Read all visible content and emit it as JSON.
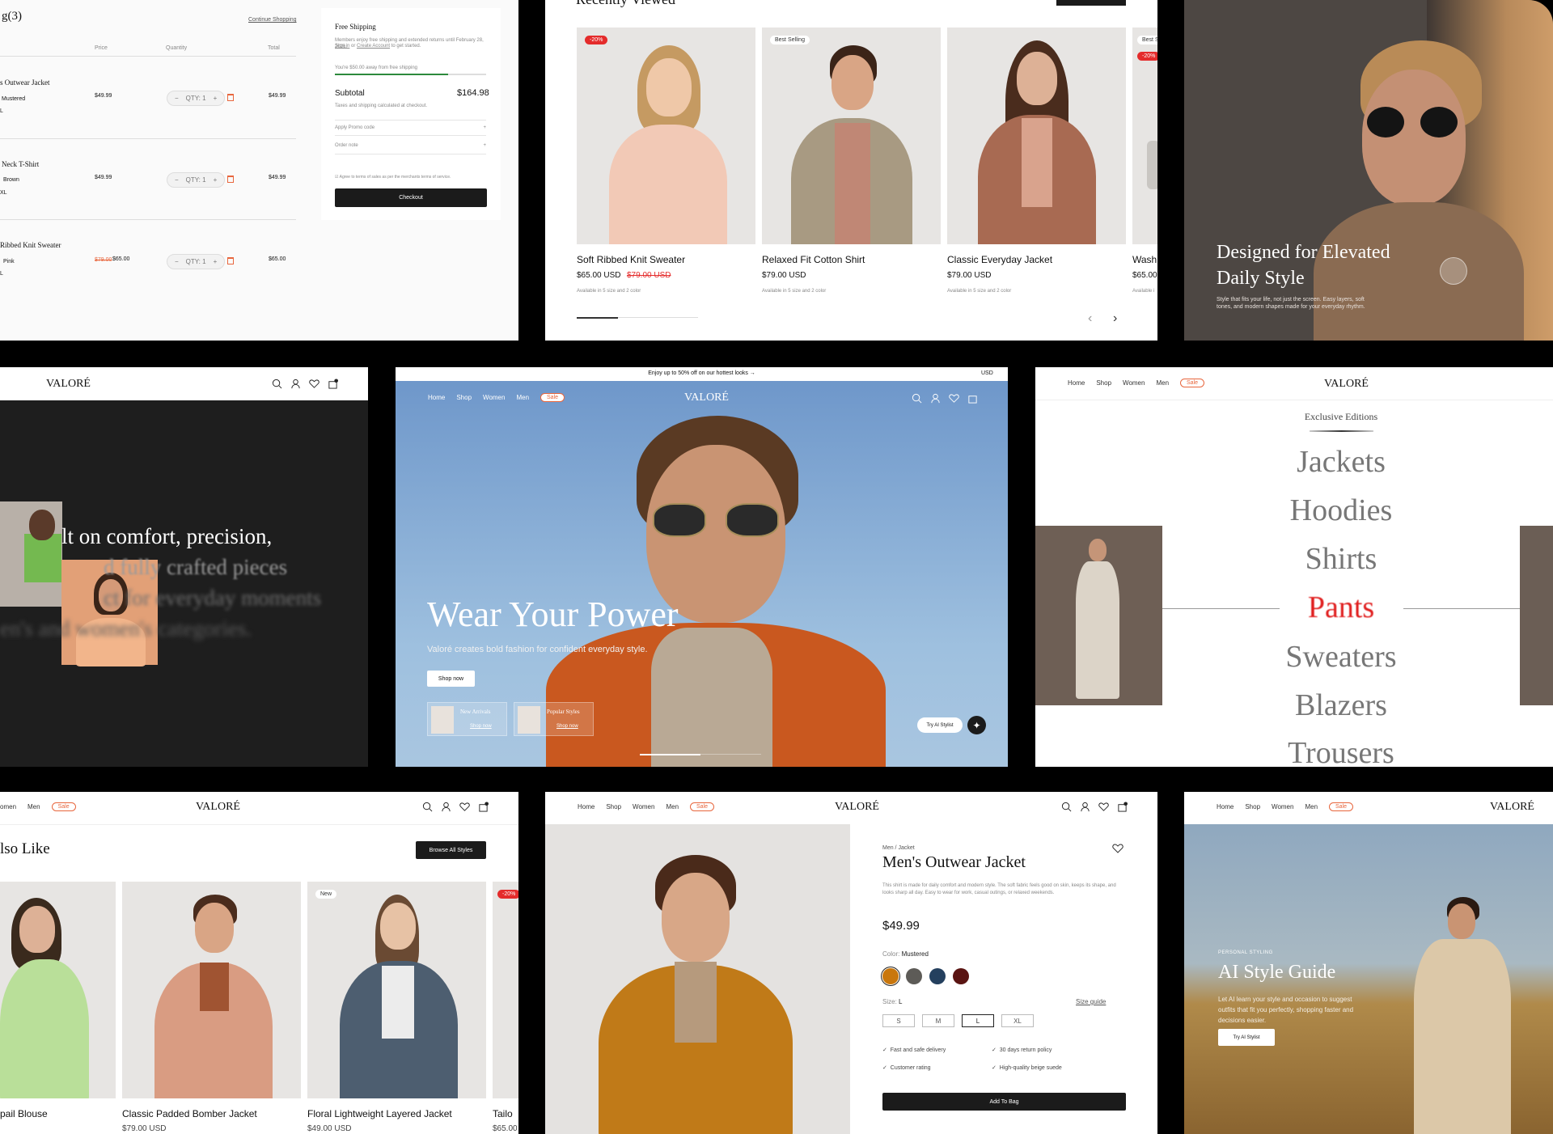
{
  "brand": "VALORÉ",
  "nav": {
    "home": "Home",
    "shop": "Shop",
    "women": "Women",
    "men": "Men",
    "sale": "Sale",
    "women_partial": "omen"
  },
  "cart": {
    "title_partial": "g(3)",
    "continue": "Continue Shopping",
    "headers": [
      "Price",
      "Quantity",
      "Total"
    ],
    "items": [
      {
        "name": "s Outwear Jacket",
        "variant": "Mustered",
        "size": "L",
        "price": "$49.99",
        "qty": "QTY: 1",
        "total": "$49.99"
      },
      {
        "name": "Neck T-Shirt",
        "variant": "Brown",
        "size": "XL",
        "price": "$49.99",
        "qty": "QTY: 1",
        "total": "$49.99"
      },
      {
        "name": "Ribbed Knit Sweater",
        "variant": "Pink",
        "size": "L",
        "old_price": "$79.00",
        "price": "$65.00",
        "qty": "QTY: 1",
        "total": "$65.00"
      }
    ],
    "summary": {
      "shipping_title": "Free Shipping",
      "shipping_text": "Members enjoy free shipping and extended returns until February 28, 2026.",
      "sign_in": "Sign in",
      "or": "or",
      "create": "Create Account",
      "to_start": "to get started.",
      "progress_text": "You're $50.00 away from free shipping",
      "progress": 0.75,
      "subtotal_label": "Subtotal",
      "subtotal": "$164.98",
      "taxes": "Taxes and shipping calculated at checkout.",
      "promo": "Apply Promo code",
      "note": "Order note",
      "terms": "Agree to terms of sales as per the merchants terms of service.",
      "checkout": "Checkout"
    }
  },
  "recent": {
    "title_partial": "Recently Viewed",
    "items": [
      {
        "badge": "-20%",
        "name": "Soft Ribbed Knit Sweater",
        "price": "$65.00 USD",
        "old": "$79.00 USD",
        "avail": "Available in 5 size and 2 color"
      },
      {
        "badge": "Best Selling",
        "name": "Relaxed Fit Cotton Shirt",
        "price": "$79.00 USD",
        "avail": "Available in 5 size and 2 color"
      },
      {
        "name": "Classic Everyday Jacket",
        "price": "$79.00 USD",
        "avail": "Available in 5 size and 2 color"
      },
      {
        "badge": "Best S",
        "badge2": "-20%",
        "name": "Wash",
        "price": "$65.00",
        "avail": "Available i"
      }
    ]
  },
  "elevated": {
    "title": "Designed for Elevated Daily Style",
    "text": "Style that fits your life, not just the screen. Easy layers, soft tones, and modern shapes made for your everyday rhythm."
  },
  "about": {
    "line1": "lt on comfort, precision,",
    "line2": "d fully crafted pieces",
    "line3": "ct for everyday moments",
    "line4": "en's and women's categories."
  },
  "hero": {
    "promo": "Enjoy up to 50% off on our hottest looks →",
    "currency": "USD",
    "title": "Wear Your Power",
    "sub": "Valoré creates bold fashion for confident everyday style.",
    "cta": "Shop now",
    "card1": "New Arrivals",
    "card2": "Popular Styles",
    "card_link": "Shop now",
    "ai": "Try AI Stylist"
  },
  "editions": {
    "title": "Exclusive Editions",
    "items": [
      "Jackets",
      "Hoodies",
      "Shirts",
      "Pants",
      "Sweaters",
      "Blazers",
      "Trousers"
    ],
    "active_index": 3
  },
  "also": {
    "title_partial": "lso Like",
    "browse": "Browse All Styles",
    "items": [
      {
        "name": "pail Blouse"
      },
      {
        "name": "Classic Padded Bomber Jacket",
        "price": "$79.00 USD"
      },
      {
        "badge": "New",
        "name": "Floral Lightweight Layered Jacket",
        "price": "$49.00 USD"
      },
      {
        "badge": "-20%",
        "name": "Tailo",
        "price": "$65.00"
      }
    ]
  },
  "product": {
    "crumb": "Men / Jacket",
    "title": "Men's Outwear Jacket",
    "desc": "This shirt is made for daily comfort and modern style. The soft fabric feels good on skin, keeps its shape, and looks sharp all day. Easy to wear for work, casual outings, or relaxed weekends.",
    "price": "$49.99",
    "color_label": "Color:",
    "color": "Mustered",
    "swatches": [
      "#c9770d",
      "#5d5b57",
      "#24405e",
      "#5a1412"
    ],
    "size_label": "Size:",
    "size": "L",
    "size_guide": "Size guide",
    "sizes": [
      "S",
      "M",
      "L",
      "XL"
    ],
    "features": [
      "Fast and safe delivery",
      "30 days return policy",
      "Customer rating",
      "High-quality beige suede"
    ],
    "add": "Add To Bag"
  },
  "ai": {
    "kicker": "PERSONAL STYLING",
    "title": "AI Style Guide",
    "text": "Let AI learn your style and occasion to suggest outfits that fit you perfectly, shopping faster and decisions easier.",
    "cta": "Try AI Stylist"
  }
}
